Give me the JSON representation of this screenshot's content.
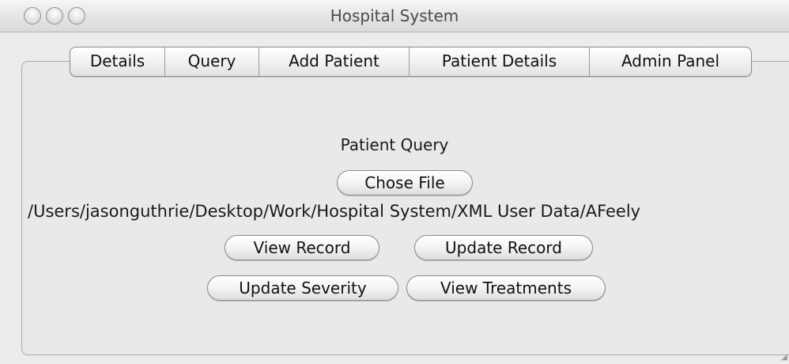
{
  "window": {
    "title": "Hospital System"
  },
  "tabs": [
    {
      "label": "Details"
    },
    {
      "label": "Query"
    },
    {
      "label": "Add Patient"
    },
    {
      "label": "Patient Details"
    },
    {
      "label": "Admin Panel"
    }
  ],
  "panel": {
    "heading": "Patient Query",
    "choose_file_label": "Chose File",
    "file_path": "/Users/jasonguthrie/Desktop/Work/Hospital System/XML User Data/AFeely",
    "view_record_label": "View Record",
    "update_record_label": "Update Record",
    "update_severity_label": "Update Severity",
    "view_treatments_label": "View Treatments"
  },
  "icons": {
    "window_controls": [
      "close-icon",
      "minimize-icon",
      "zoom-icon"
    ],
    "resize": "resize-grip-icon"
  }
}
